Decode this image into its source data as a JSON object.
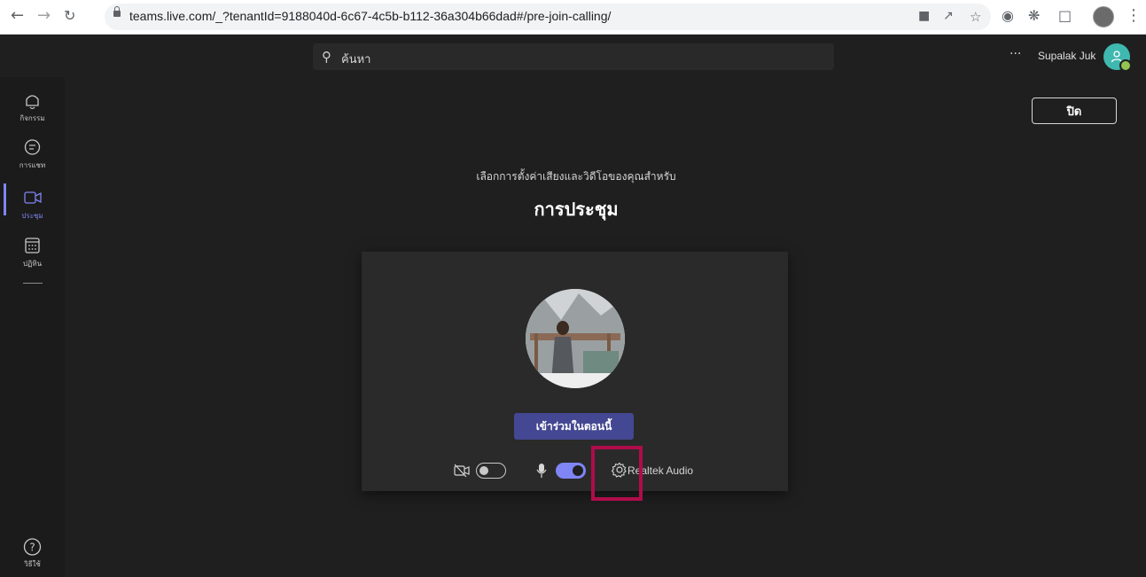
{
  "browser": {
    "url": "teams.live.com/_?tenantId=9188040d-6c67-4c5b-b112-36a304b66dad#/pre-join-calling/",
    "nav_icons": [
      "arrow-left-icon",
      "arrow-right-icon",
      "reload-icon"
    ],
    "toolbar_icons": [
      "camera-icon",
      "share-icon",
      "star-icon",
      "screenshot-icon",
      "extensions-icon",
      "sidebar-icon",
      "profile-icon",
      "menu-icon"
    ]
  },
  "topbar": {
    "search_placeholder": "ค้นหา",
    "more": "···",
    "user_name": "Supalak Juk",
    "presence": "available"
  },
  "rail": {
    "items": [
      {
        "label": "กิจกรรม",
        "icon": "bell-icon"
      },
      {
        "label": "การแชท",
        "icon": "chat-icon"
      },
      {
        "label": "ประชุม",
        "icon": "video-icon",
        "active": true
      },
      {
        "label": "ปฏิทิน",
        "icon": "calendar-icon"
      }
    ],
    "help": {
      "label": "วิธีใช้",
      "icon": "help-icon"
    }
  },
  "main": {
    "close_label": "ปิด",
    "subtitle": "เลือกการตั้งค่าเสียงและวิดีโอของคุณสำหรับ",
    "title": "การประชุม",
    "join_label": "เข้าร่วมในตอนนี้",
    "camera_on": false,
    "mic_on": true,
    "audio_device": "Realtek Audio"
  },
  "colors": {
    "accent": "#7f85f5",
    "join_button": "#444791",
    "highlight": "#b00c4b"
  }
}
